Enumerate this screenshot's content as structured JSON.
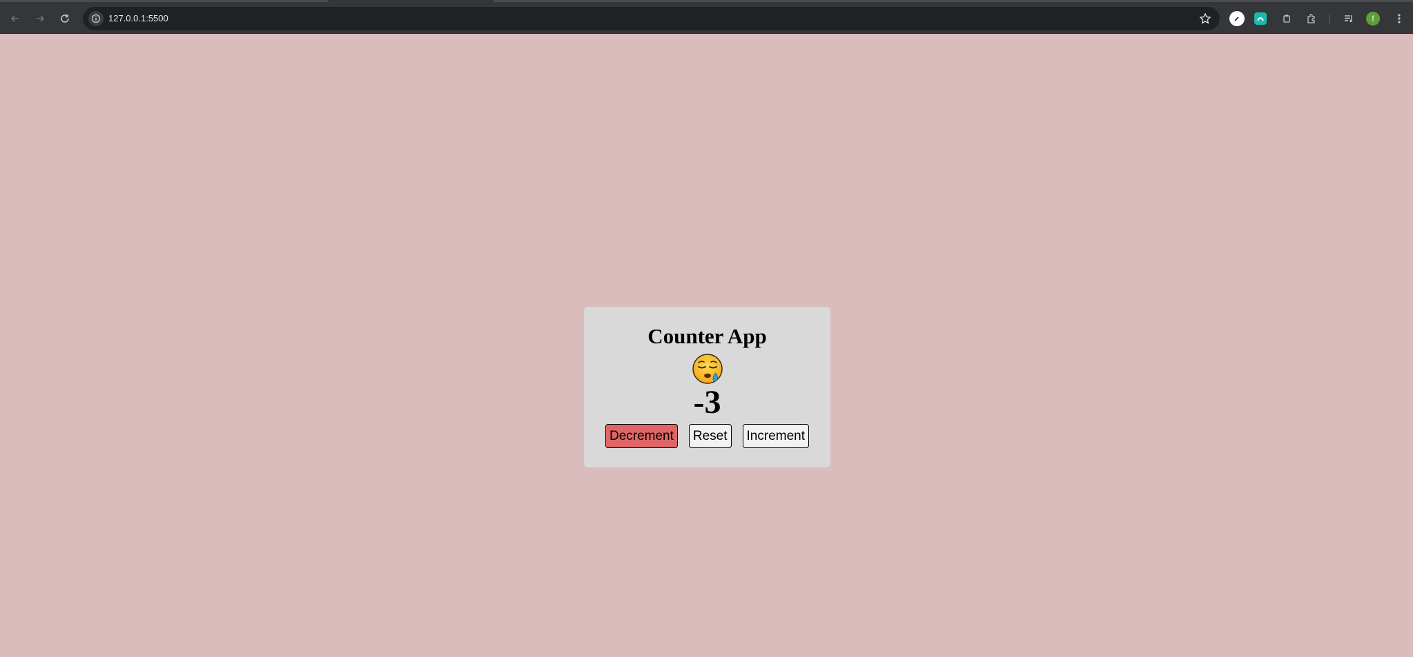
{
  "browser": {
    "url": "127.0.0.1:5500",
    "profile_initial": "f",
    "icons": [
      "back-arrow-icon",
      "forward-arrow-icon",
      "reload-icon",
      "site-info-icon",
      "bookmark-star-icon",
      "extension-icon",
      "puzzle-icon",
      "media-icon",
      "profile-icon",
      "menu-icon"
    ]
  },
  "app": {
    "title": "Counter App",
    "emoji": "sleepy-face",
    "count": "-3",
    "buttons": {
      "decrement": "Decrement",
      "reset": "Reset",
      "increment": "Increment"
    }
  },
  "colors": {
    "page_bg": "#dbbcbd",
    "card_bg": "#d9d9d9",
    "decrement_bg": "#e06666"
  }
}
